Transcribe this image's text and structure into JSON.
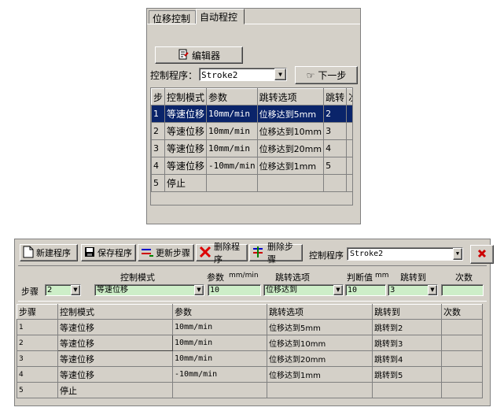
{
  "top": {
    "tabs": [
      {
        "label": "位移控制"
      },
      {
        "label": "自动程控"
      }
    ],
    "editor_button": "编辑器",
    "program_label": "控制程序：",
    "program_value": "Stroke2",
    "next_button": "下一步",
    "table": {
      "headers": [
        "步",
        "控制模式",
        "参数",
        "跳转选项",
        "跳转",
        "次"
      ],
      "rows": [
        [
          "1",
          "等速位移",
          "10mm/min",
          "位移达到5mm",
          "2",
          ""
        ],
        [
          "2",
          "等速位移",
          "10mm/min",
          "位移达到10mm",
          "3",
          ""
        ],
        [
          "3",
          "等速位移",
          "10mm/min",
          "位移达到20mm",
          "4",
          ""
        ],
        [
          "4",
          "等速位移",
          "-10mm/min",
          "位移达到1mm",
          "5",
          ""
        ],
        [
          "5",
          "停止",
          "",
          "",
          "",
          ""
        ]
      ],
      "selected_row": 1
    }
  },
  "bottom": {
    "toolbar": {
      "new": "新建程序",
      "save": "保存程序",
      "update": "更新步骤",
      "delete_prog": "删除程序",
      "delete_step": "删除步骤",
      "ctrl_label": "控制程序",
      "ctrl_value": "Stroke2"
    },
    "fields": {
      "step_label": "步骤",
      "step_value": "2",
      "mode_label": "控制模式",
      "mode_value": "等速位移",
      "param_label": "参数",
      "param_unit": "mm/min",
      "param_value": "10",
      "jump_opt_label": "跳转选项",
      "jump_opt_value": "位移达到",
      "judge_label": "判断值",
      "judge_unit": "mm",
      "judge_value": "10",
      "jump_to_label": "跳转到",
      "jump_to_value": "3",
      "count_label": "次数",
      "count_value": ""
    },
    "table": {
      "headers": [
        "步骤",
        "控制模式",
        "参数",
        "跳转选项",
        "跳转到",
        "次数"
      ],
      "rows": [
        [
          "1",
          "等速位移",
          "10mm/min",
          "位移达到5mm",
          "跳转到2",
          ""
        ],
        [
          "2",
          "等速位移",
          "10mm/min",
          "位移达到10mm",
          "跳转到3",
          ""
        ],
        [
          "3",
          "等速位移",
          "10mm/min",
          "位移达到20mm",
          "跳转到4",
          ""
        ],
        [
          "4",
          "等速位移",
          "-10mm/min",
          "位移达到1mm",
          "跳转到5",
          ""
        ],
        [
          "5",
          "停止",
          "",
          "",
          "",
          ""
        ]
      ]
    }
  },
  "colors": {
    "face": "#d4d0c8",
    "selection": "#0a246a",
    "edit_green": "#cdeec8",
    "close_red": "#cc0000"
  }
}
